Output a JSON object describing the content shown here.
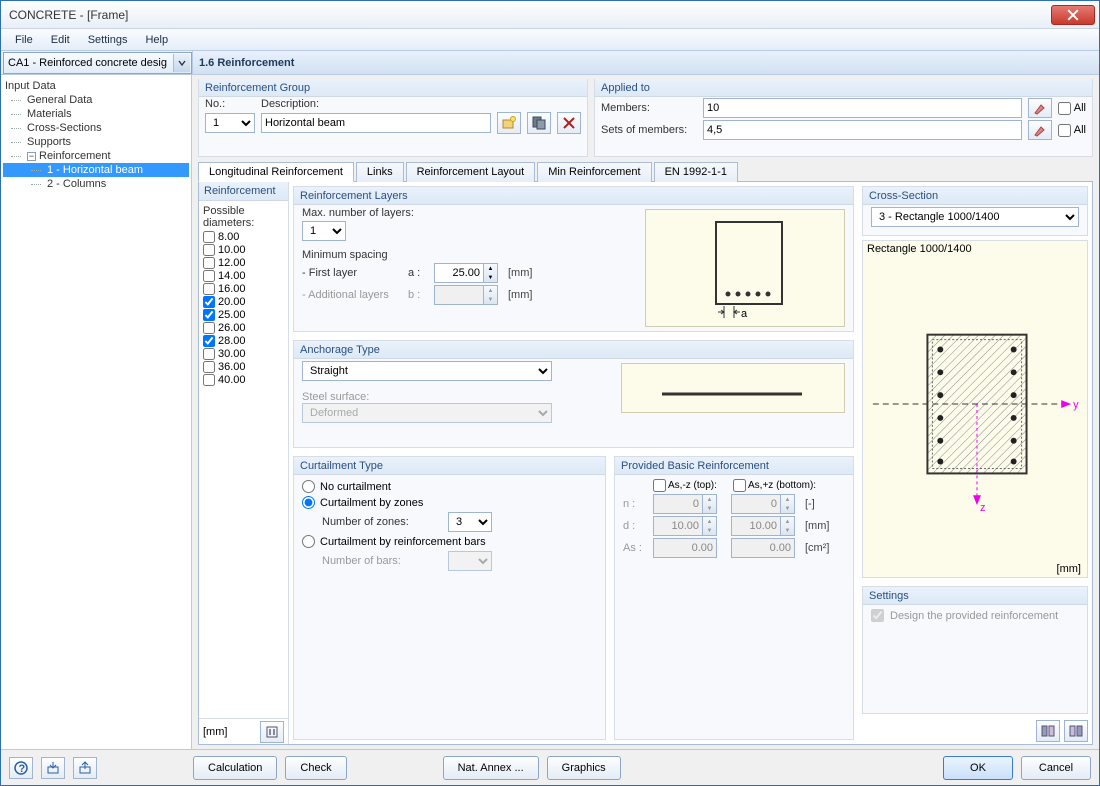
{
  "window": {
    "title": "CONCRETE - [Frame]"
  },
  "menu": [
    "File",
    "Edit",
    "Settings",
    "Help"
  ],
  "combo_top": "CA1 - Reinforced concrete desig",
  "section_title": "1.6 Reinforcement",
  "tree": {
    "root": "Input Data",
    "items": [
      "General Data",
      "Materials",
      "Cross-Sections",
      "Supports"
    ],
    "reinf": "Reinforcement",
    "children": [
      "1 - Horizontal beam",
      "2 - Columns"
    ]
  },
  "reinf_group": {
    "title": "Reinforcement Group",
    "no_label": "No.:",
    "no_value": "1",
    "desc_label": "Description:",
    "desc_value": "Horizontal beam"
  },
  "applied": {
    "title": "Applied to",
    "members_label": "Members:",
    "members_value": "10",
    "sets_label": "Sets of members:",
    "sets_value": "4,5",
    "all": "All"
  },
  "tabs": [
    "Longitudinal Reinforcement",
    "Links",
    "Reinforcement Layout",
    "Min Reinforcement",
    "EN 1992-1-1"
  ],
  "reinforcement_panel": {
    "title": "Reinforcement",
    "possible_label": "Possible diameters:",
    "diameters": [
      {
        "v": "8.00",
        "c": false
      },
      {
        "v": "10.00",
        "c": false
      },
      {
        "v": "12.00",
        "c": false
      },
      {
        "v": "14.00",
        "c": false
      },
      {
        "v": "16.00",
        "c": false
      },
      {
        "v": "20.00",
        "c": true
      },
      {
        "v": "25.00",
        "c": true
      },
      {
        "v": "26.00",
        "c": false
      },
      {
        "v": "28.00",
        "c": true
      },
      {
        "v": "30.00",
        "c": false
      },
      {
        "v": "36.00",
        "c": false
      },
      {
        "v": "40.00",
        "c": false
      }
    ],
    "unit": "[mm]"
  },
  "layers": {
    "title": "Reinforcement Layers",
    "max_label": "Max. number of layers:",
    "max_value": "1",
    "spacing_label": "Minimum spacing",
    "first_label": "- First layer",
    "first_var": "a :",
    "first_value": "25.00",
    "add_label": "- Additional layers",
    "add_var": "b :",
    "unit": "[mm]"
  },
  "anchorage": {
    "title": "Anchorage Type",
    "type_value": "Straight",
    "surface_label": "Steel surface:",
    "surface_value": "Deformed"
  },
  "curtailment": {
    "title": "Curtailment Type",
    "none": "No curtailment",
    "zones": "Curtailment by zones",
    "zones_num_label": "Number of zones:",
    "zones_num_value": "3",
    "bars": "Curtailment by reinforcement bars",
    "bars_num_label": "Number of bars:"
  },
  "provided": {
    "title": "Provided Basic Reinforcement",
    "as_top": "As,-z (top):",
    "as_bottom": "As,+z (bottom):",
    "n_label": "n :",
    "n_top": "0",
    "n_bottom": "0",
    "n_unit": "[-]",
    "d_label": "d :",
    "d_top": "10.00",
    "d_bottom": "10.00",
    "d_unit": "[mm]",
    "as_label": "As :",
    "as_top_v": "0.00",
    "as_bottom_v": "0.00",
    "as_unit": "[cm²]"
  },
  "cross_section": {
    "title": "Cross-Section",
    "value": "3 - Rectangle 1000/1400",
    "caption": "Rectangle 1000/1400",
    "unit": "[mm]"
  },
  "settings": {
    "title": "Settings",
    "design_label": "Design the provided reinforcement"
  },
  "buttons": {
    "calc": "Calculation",
    "check": "Check",
    "annex": "Nat. Annex ...",
    "graphics": "Graphics",
    "ok": "OK",
    "cancel": "Cancel"
  }
}
